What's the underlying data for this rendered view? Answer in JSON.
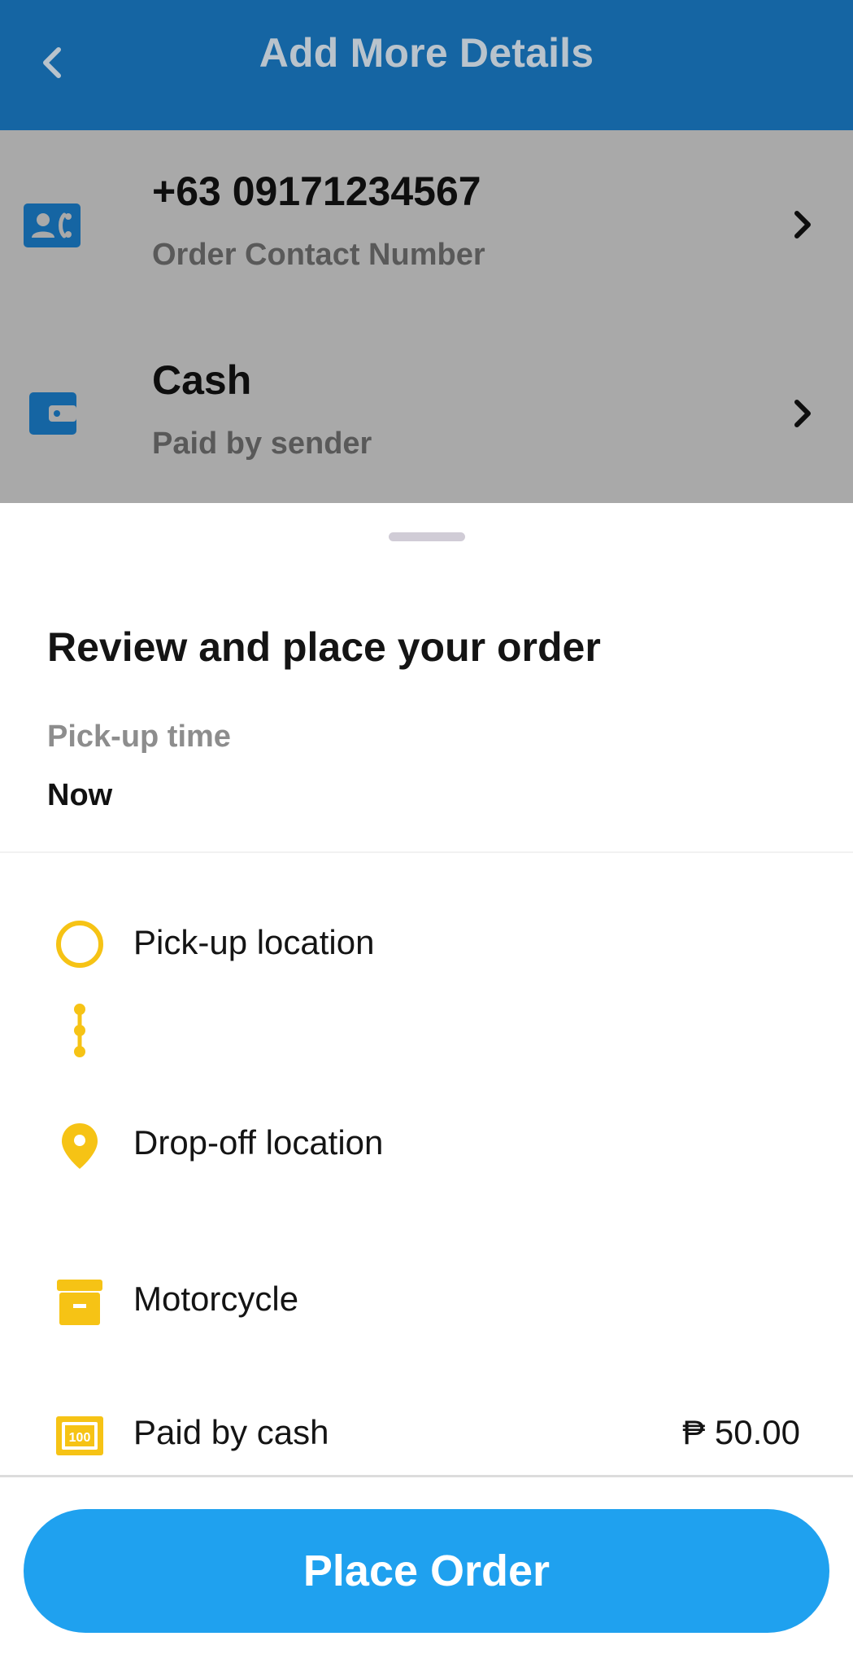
{
  "header": {
    "title": "Add More Details",
    "back_icon": "chevron-left-icon",
    "background": "#1565a3"
  },
  "details": {
    "contact": {
      "number": "+63 09171234567",
      "label": "Order Contact Number",
      "icon": "contact-card-icon",
      "chevron": "chevron-right-icon"
    },
    "payment": {
      "method": "Cash",
      "label": "Paid by sender",
      "icon": "wallet-icon",
      "chevron": "chevron-right-icon"
    }
  },
  "sheet": {
    "title": "Review and place your order",
    "pickup_time_label": "Pick-up time",
    "pickup_time_value": "Now",
    "items": [
      {
        "icon": "pickup-circle-icon",
        "text": "Pick-up location"
      },
      {
        "icon": "location-pin-icon",
        "text": "Drop-off location"
      },
      {
        "icon": "vehicle-box-icon",
        "text": "Motorcycle"
      },
      {
        "icon": "cash-bill-icon",
        "text": "Paid by cash",
        "amount": "₱ 50.00"
      }
    ],
    "accent_yellow": "#f6c315"
  },
  "action": {
    "place_order_label": "Place Order",
    "color": "#1fa1ef"
  }
}
